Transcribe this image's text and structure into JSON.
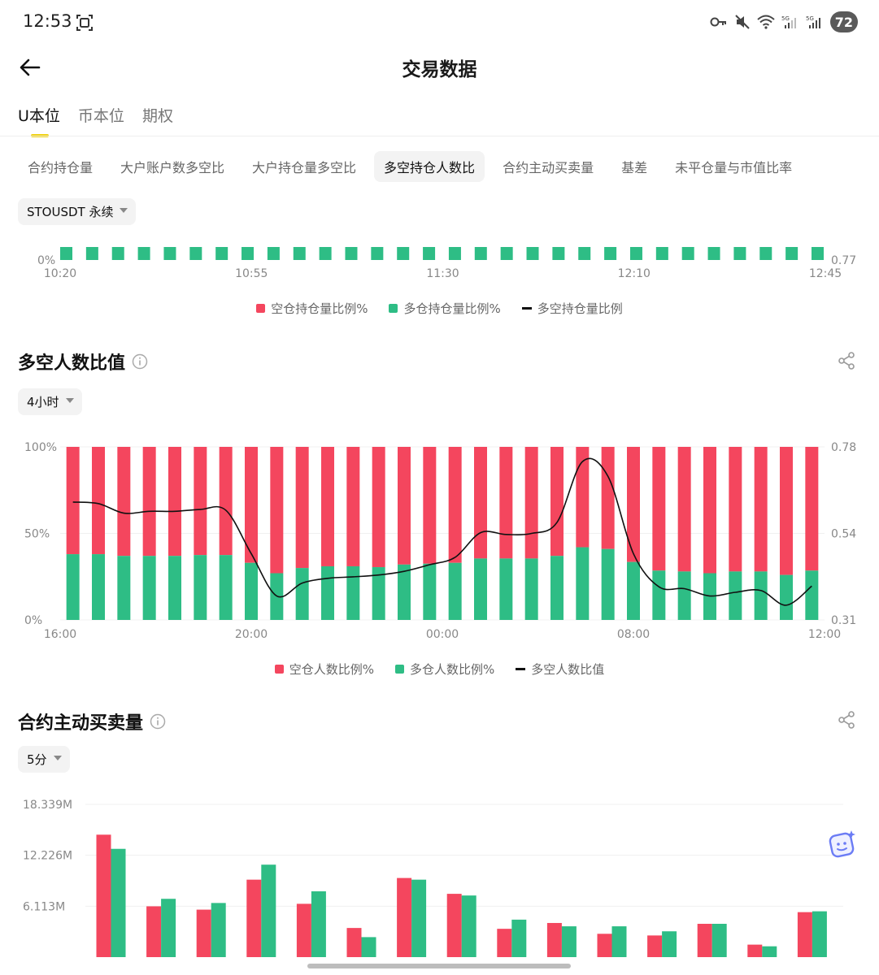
{
  "status_bar": {
    "time": "12:53",
    "battery": "72"
  },
  "header": {
    "title": "交易数据"
  },
  "main_tabs": [
    {
      "label": "U本位",
      "active": true
    },
    {
      "label": "币本位",
      "active": false
    },
    {
      "label": "期权",
      "active": false
    }
  ],
  "sub_tabs": [
    {
      "label": "合约持仓量",
      "active": false
    },
    {
      "label": "大户账户数多空比",
      "active": false
    },
    {
      "label": "大户持仓量多空比",
      "active": false
    },
    {
      "label": "多空持仓人数比",
      "active": true
    },
    {
      "label": "合约主动买卖量",
      "active": false
    },
    {
      "label": "基差",
      "active": false
    },
    {
      "label": "未平仓量与市值比率",
      "active": false
    }
  ],
  "symbol_selector": {
    "label": "STOUSDT 永续"
  },
  "colors": {
    "short": "#f4465e",
    "long": "#2ebd85",
    "ratio_line": "#111111",
    "accent": "#f0d214"
  },
  "chart1": {
    "legend": {
      "short": "空仓持仓量比例%",
      "long": "多仓持仓量比例%",
      "ratio": "多空持仓量比例"
    }
  },
  "section2": {
    "title": "多空人数比值",
    "interval": "4小时"
  },
  "chart2": {
    "legend": {
      "short": "空仓人数比例%",
      "long": "多仓人数比例%",
      "ratio": "多空人数比值"
    }
  },
  "section3": {
    "title": "合约主动买卖量",
    "interval": "5分"
  },
  "chart_data": [
    {
      "type": "bar",
      "x_ticks": [
        "10:20",
        "10:55",
        "11:30",
        "12:10",
        "12:45"
      ],
      "left_axis_label": "0%",
      "right_axis_label": "0.77",
      "bar_count": 30,
      "series": [
        {
          "name": "多仓持仓量比例%",
          "color": "#2ebd85"
        }
      ]
    },
    {
      "type": "bar",
      "x_ticks": [
        "16:00",
        "20:00",
        "00:00",
        "08:00",
        "12:00"
      ],
      "ylim_left": [
        0,
        100
      ],
      "left_ticks": [
        "100%",
        "50%",
        "0%"
      ],
      "right_ticks": [
        "0.78",
        "0.54",
        "0.31"
      ],
      "ylim_right": [
        0.31,
        0.78
      ],
      "long_pct": [
        38,
        38,
        37,
        37,
        37,
        37.5,
        37.5,
        33,
        27,
        30,
        31,
        31,
        30.5,
        32,
        32.5,
        33,
        35.5,
        35.5,
        35.5,
        37,
        42,
        41,
        33.5,
        28.5,
        28,
        27,
        28,
        28,
        26,
        28.5
      ],
      "ratio": [
        0.63,
        0.626,
        0.6,
        0.605,
        0.605,
        0.61,
        0.608,
        0.49,
        0.375,
        0.41,
        0.423,
        0.427,
        0.432,
        0.442,
        0.46,
        0.48,
        0.547,
        0.542,
        0.545,
        0.575,
        0.74,
        0.7,
        0.49,
        0.4,
        0.395,
        0.375,
        0.385,
        0.39,
        0.35,
        0.402
      ],
      "series": [
        {
          "name": "空仓人数比例%",
          "color": "#f4465e"
        },
        {
          "name": "多仓人数比例%",
          "color": "#2ebd85"
        },
        {
          "name": "多空人数比值",
          "color": "#111111"
        }
      ]
    },
    {
      "type": "bar",
      "y_ticks": [
        "18.339M",
        "12.226M",
        "6.113M"
      ],
      "y_tick_values": [
        18.339,
        12.226,
        6.113
      ],
      "sell": [
        14.7,
        6.1,
        5.7,
        9.3,
        6.4,
        3.5,
        9.5,
        7.6,
        3.4,
        4.1,
        2.8,
        2.6,
        4.0,
        1.5,
        5.4
      ],
      "buy": [
        13.0,
        7.0,
        6.5,
        11.1,
        7.9,
        2.4,
        9.3,
        7.4,
        4.5,
        3.7,
        3.7,
        3.1,
        4.0,
        1.3,
        5.5
      ]
    }
  ]
}
